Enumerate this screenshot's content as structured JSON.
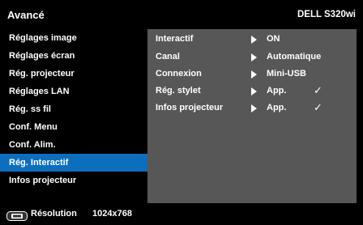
{
  "header": {
    "title": "Avancé",
    "model": "DELL S320wi"
  },
  "sidebar": {
    "items": [
      {
        "label": "Réglages image"
      },
      {
        "label": "Réglages écran"
      },
      {
        "label": "Rég. projecteur"
      },
      {
        "label": "Réglages LAN"
      },
      {
        "label": "Rég. ss fil"
      },
      {
        "label": "Conf. Menu"
      },
      {
        "label": "Conf. Alim."
      },
      {
        "label": "Rég. Interactif",
        "selected": true
      },
      {
        "label": "Infos projecteur"
      }
    ]
  },
  "panel": {
    "rows": [
      {
        "label": "Interactif",
        "value": "ON"
      },
      {
        "label": "Canal",
        "value": "Automatique"
      },
      {
        "label": "Connexion",
        "value": "Mini-USB"
      },
      {
        "label": "Rég. stylet",
        "value": "App.",
        "check": "✓"
      },
      {
        "label": "Infos projecteur",
        "value": "App.",
        "check": "✓"
      }
    ]
  },
  "footer": {
    "label": "Résolution",
    "value": "1024x768",
    "icon": "display-icon"
  },
  "colors": {
    "accent": "#0d6ebe",
    "panel": "#575757",
    "background": "#000000"
  }
}
